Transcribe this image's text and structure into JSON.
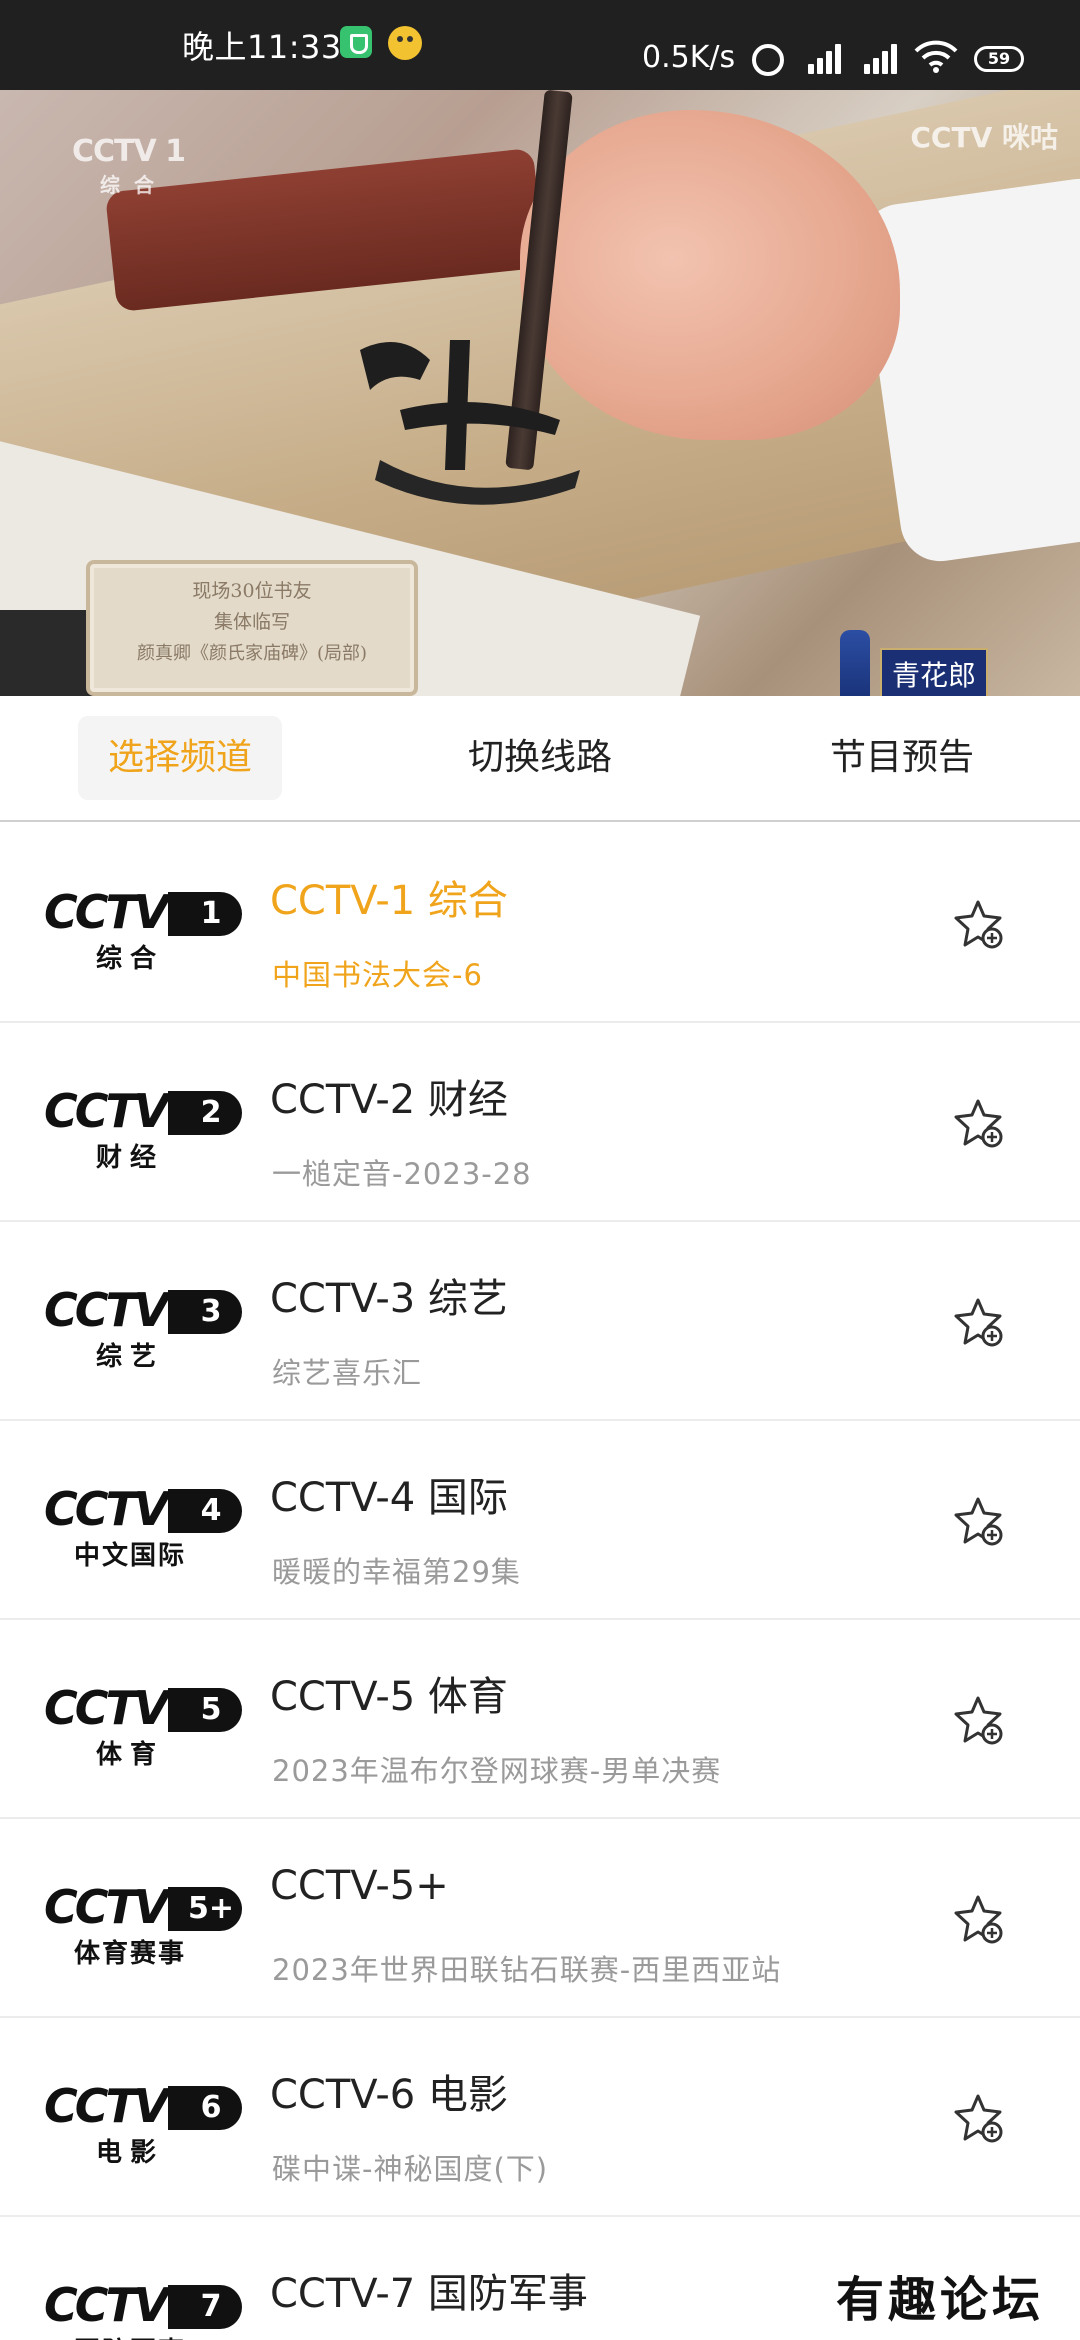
{
  "status_bar": {
    "time": "晚上11:33",
    "net_speed": "0.5K/s",
    "battery": "59"
  },
  "video": {
    "watermark_channel": "CCTV 1",
    "watermark_sub": "综合",
    "watermark_app": "CCTV 咪咕",
    "caption_lines": [
      "现场30位书友",
      "集体临写",
      "颜真卿《颜氏家庙碑》(局部)"
    ],
    "sponsor": "青花郎"
  },
  "tabs": [
    {
      "label": "选择频道",
      "active": true
    },
    {
      "label": "切换线路",
      "active": false
    },
    {
      "label": "节目预告",
      "active": false
    }
  ],
  "channels": [
    {
      "logo_num": "1",
      "logo_sub": "综合",
      "name": "CCTV-1 综合",
      "program": "中国书法大会-6",
      "active": true
    },
    {
      "logo_num": "2",
      "logo_sub": "财经",
      "name": "CCTV-2 财经",
      "program": "一槌定音-2023-28",
      "active": false
    },
    {
      "logo_num": "3",
      "logo_sub": "综艺",
      "name": "CCTV-3 综艺",
      "program": "综艺喜乐汇",
      "active": false
    },
    {
      "logo_num": "4",
      "logo_sub": "中文国际",
      "name": "CCTV-4 国际",
      "program": "暖暖的幸福第29集",
      "active": false
    },
    {
      "logo_num": "5",
      "logo_sub": "体育",
      "name": "CCTV-5 体育",
      "program": "2023年温布尔登网球赛-男单决赛",
      "active": false
    },
    {
      "logo_num": "5+",
      "logo_sub": "体育赛事",
      "name": "CCTV-5+",
      "program": "2023年世界田联钻石联赛-西里西亚站",
      "active": false
    },
    {
      "logo_num": "6",
      "logo_sub": "电影",
      "name": "CCTV-6 电影",
      "program": "碟中谍-神秘国度(下)",
      "active": false
    },
    {
      "logo_num": "7",
      "logo_sub": "国防军事",
      "name": "CCTV-7 国防军事",
      "program": "",
      "active": false
    }
  ],
  "logo_word": "CCTV",
  "forum_watermark": "有趣论坛",
  "colors": {
    "accent": "#f0a41b",
    "statusbar": "#202020",
    "text": "#222222",
    "subtext": "#9a9a9a"
  }
}
